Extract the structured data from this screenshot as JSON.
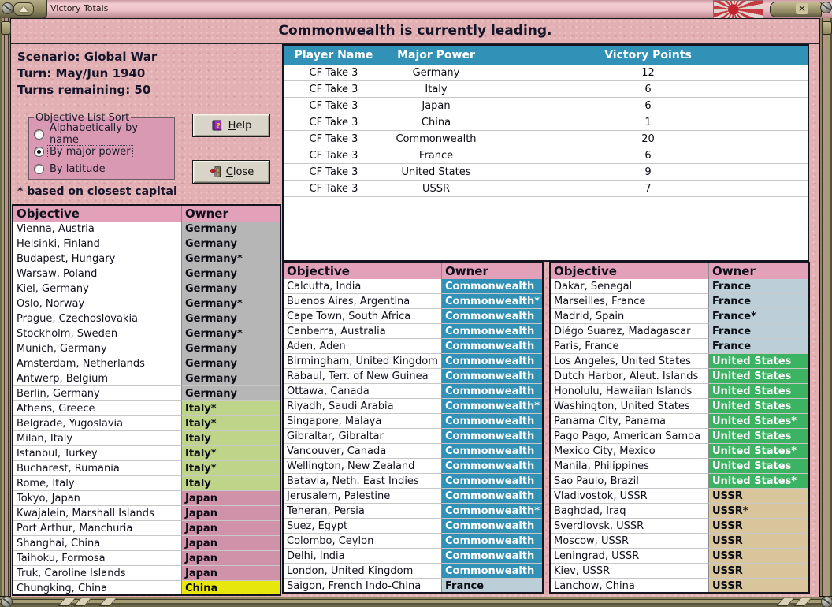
{
  "window": {
    "title": "Victory Totals"
  },
  "banner": {
    "text": "Commonwealth is currently leading."
  },
  "info": {
    "scenario": "Scenario: Global War",
    "turn": "Turn: May/Jun 1940",
    "turns_remaining": "Turns remaining: 50"
  },
  "sort_box": {
    "label": "Objective List Sort",
    "options": [
      {
        "label": "Alphabetically by name",
        "selected": false
      },
      {
        "label": "By major power",
        "selected": true
      },
      {
        "label": "By latitude",
        "selected": false
      }
    ]
  },
  "footnote": "* based on closest capital",
  "buttons": {
    "help": "Help",
    "close": "Close"
  },
  "victory_table": {
    "headers": [
      "Player Name",
      "Major Power",
      "Victory Points"
    ],
    "rows": [
      [
        "CF Take 3",
        "Germany",
        "12"
      ],
      [
        "CF Take 3",
        "Italy",
        "6"
      ],
      [
        "CF Take 3",
        "Japan",
        "6"
      ],
      [
        "CF Take 3",
        "China",
        "1"
      ],
      [
        "CF Take 3",
        "Commonwealth",
        "20"
      ],
      [
        "CF Take 3",
        "France",
        "6"
      ],
      [
        "CF Take 3",
        "United States",
        "9"
      ],
      [
        "CF Take 3",
        "USSR",
        "7"
      ]
    ]
  },
  "objective_tables": {
    "headers": [
      "Objective",
      "Owner"
    ],
    "left": [
      {
        "objective": "Vienna, Austria",
        "owner": "Germany",
        "power": "germany"
      },
      {
        "objective": "Helsinki, Finland",
        "owner": "Germany",
        "power": "germany"
      },
      {
        "objective": "Budapest, Hungary",
        "owner": "Germany*",
        "power": "germany"
      },
      {
        "objective": "Warsaw, Poland",
        "owner": "Germany",
        "power": "germany"
      },
      {
        "objective": "Kiel, Germany",
        "owner": "Germany",
        "power": "germany"
      },
      {
        "objective": "Oslo, Norway",
        "owner": "Germany*",
        "power": "germany"
      },
      {
        "objective": "Prague, Czechoslovakia",
        "owner": "Germany",
        "power": "germany"
      },
      {
        "objective": "Stockholm, Sweden",
        "owner": "Germany*",
        "power": "germany"
      },
      {
        "objective": "Munich, Germany",
        "owner": "Germany",
        "power": "germany"
      },
      {
        "objective": "Amsterdam, Netherlands",
        "owner": "Germany",
        "power": "germany"
      },
      {
        "objective": "Antwerp, Belgium",
        "owner": "Germany",
        "power": "germany"
      },
      {
        "objective": "Berlin, Germany",
        "owner": "Germany",
        "power": "germany"
      },
      {
        "objective": "Athens, Greece",
        "owner": "Italy*",
        "power": "italy"
      },
      {
        "objective": "Belgrade, Yugoslavia",
        "owner": "Italy*",
        "power": "italy"
      },
      {
        "objective": "Milan, Italy",
        "owner": "Italy",
        "power": "italy"
      },
      {
        "objective": "Istanbul, Turkey",
        "owner": "Italy*",
        "power": "italy"
      },
      {
        "objective": "Bucharest, Rumania",
        "owner": "Italy*",
        "power": "italy"
      },
      {
        "objective": "Rome, Italy",
        "owner": "Italy",
        "power": "italy"
      },
      {
        "objective": "Tokyo, Japan",
        "owner": "Japan",
        "power": "japan"
      },
      {
        "objective": "Kwajalein, Marshall Islands",
        "owner": "Japan",
        "power": "japan"
      },
      {
        "objective": "Port Arthur, Manchuria",
        "owner": "Japan",
        "power": "japan"
      },
      {
        "objective": "Shanghai, China",
        "owner": "Japan",
        "power": "japan"
      },
      {
        "objective": "Taihoku, Formosa",
        "owner": "Japan",
        "power": "japan"
      },
      {
        "objective": "Truk, Caroline Islands",
        "owner": "Japan",
        "power": "japan"
      },
      {
        "objective": "Chungking, China",
        "owner": "China",
        "power": "china"
      }
    ],
    "middle": [
      {
        "objective": "Calcutta, India",
        "owner": "Commonwealth",
        "power": "commonwealth"
      },
      {
        "objective": "Buenos Aires, Argentina",
        "owner": "Commonwealth*",
        "power": "commonwealth"
      },
      {
        "objective": "Cape Town, South Africa",
        "owner": "Commonwealth",
        "power": "commonwealth"
      },
      {
        "objective": "Canberra, Australia",
        "owner": "Commonwealth",
        "power": "commonwealth"
      },
      {
        "objective": "Aden, Aden",
        "owner": "Commonwealth",
        "power": "commonwealth"
      },
      {
        "objective": "Birmingham, United Kingdom",
        "owner": "Commonwealth",
        "power": "commonwealth"
      },
      {
        "objective": "Rabaul, Terr. of New Guinea",
        "owner": "Commonwealth",
        "power": "commonwealth"
      },
      {
        "objective": "Ottawa, Canada",
        "owner": "Commonwealth",
        "power": "commonwealth"
      },
      {
        "objective": "Riyadh, Saudi Arabia",
        "owner": "Commonwealth*",
        "power": "commonwealth"
      },
      {
        "objective": "Singapore, Malaya",
        "owner": "Commonwealth",
        "power": "commonwealth"
      },
      {
        "objective": "Gibraltar, Gibraltar",
        "owner": "Commonwealth",
        "power": "commonwealth"
      },
      {
        "objective": "Vancouver, Canada",
        "owner": "Commonwealth",
        "power": "commonwealth"
      },
      {
        "objective": "Wellington, New Zealand",
        "owner": "Commonwealth",
        "power": "commonwealth"
      },
      {
        "objective": "Batavia, Neth. East Indies",
        "owner": "Commonwealth",
        "power": "commonwealth"
      },
      {
        "objective": "Jerusalem, Palestine",
        "owner": "Commonwealth",
        "power": "commonwealth"
      },
      {
        "objective": "Teheran, Persia",
        "owner": "Commonwealth*",
        "power": "commonwealth"
      },
      {
        "objective": "Suez, Egypt",
        "owner": "Commonwealth",
        "power": "commonwealth"
      },
      {
        "objective": "Colombo, Ceylon",
        "owner": "Commonwealth",
        "power": "commonwealth"
      },
      {
        "objective": "Delhi, India",
        "owner": "Commonwealth",
        "power": "commonwealth"
      },
      {
        "objective": "London, United Kingdom",
        "owner": "Commonwealth",
        "power": "commonwealth"
      },
      {
        "objective": "Saigon, French Indo-China",
        "owner": "France",
        "power": "france"
      }
    ],
    "right": [
      {
        "objective": "Dakar, Senegal",
        "owner": "France",
        "power": "france"
      },
      {
        "objective": "Marseilles, France",
        "owner": "France",
        "power": "france"
      },
      {
        "objective": "Madrid, Spain",
        "owner": "France*",
        "power": "france"
      },
      {
        "objective": "Diégo Suarez, Madagascar",
        "owner": "France",
        "power": "france"
      },
      {
        "objective": "Paris, France",
        "owner": "France",
        "power": "france"
      },
      {
        "objective": "Los Angeles, United States",
        "owner": "United States",
        "power": "united_states"
      },
      {
        "objective": "Dutch Harbor, Aleut. Islands",
        "owner": "United States",
        "power": "united_states"
      },
      {
        "objective": "Honolulu, Hawaiian Islands",
        "owner": "United States",
        "power": "united_states"
      },
      {
        "objective": "Washington, United States",
        "owner": "United States",
        "power": "united_states"
      },
      {
        "objective": "Panama City, Panama",
        "owner": "United States*",
        "power": "united_states"
      },
      {
        "objective": "Pago Pago, American Samoa",
        "owner": "United States",
        "power": "united_states"
      },
      {
        "objective": "Mexico City, Mexico",
        "owner": "United States*",
        "power": "united_states"
      },
      {
        "objective": "Manila, Philippines",
        "owner": "United States",
        "power": "united_states"
      },
      {
        "objective": "Sao Paulo, Brazil",
        "owner": "United States*",
        "power": "united_states"
      },
      {
        "objective": "Vladivostok, USSR",
        "owner": "USSR",
        "power": "ussr"
      },
      {
        "objective": "Baghdad, Iraq",
        "owner": "USSR*",
        "power": "ussr"
      },
      {
        "objective": "Sverdlovsk, USSR",
        "owner": "USSR",
        "power": "ussr"
      },
      {
        "objective": "Moscow, USSR",
        "owner": "USSR",
        "power": "ussr"
      },
      {
        "objective": "Leningrad, USSR",
        "owner": "USSR",
        "power": "ussr"
      },
      {
        "objective": "Kiev, USSR",
        "owner": "USSR",
        "power": "ussr"
      },
      {
        "objective": "Lanchow, China",
        "owner": "USSR",
        "power": "ussr"
      }
    ]
  },
  "power_colors": {
    "germany": {
      "bg": "#b6b6b6",
      "fg": "#0c0c14"
    },
    "italy": {
      "bg": "#bed489",
      "fg": "#0c0c14"
    },
    "japan": {
      "bg": "#d092a9",
      "fg": "#0c0c14"
    },
    "china": {
      "bg": "#e7e70e",
      "fg": "#0c0c14"
    },
    "commonwealth": {
      "bg": "#3191b7",
      "fg": "#ffffff"
    },
    "france": {
      "bg": "#bccfd8",
      "fg": "#0c0c14"
    },
    "united_states": {
      "bg": "#3cb263",
      "fg": "#ffffff"
    },
    "ussr": {
      "bg": "#d8c59b",
      "fg": "#0c0c14"
    }
  },
  "theme": {
    "header_teal": "#3191b7",
    "header_pink": "#e2a1b9",
    "page_pink": "#e2afb3",
    "frame_olive": "#8d855f"
  }
}
